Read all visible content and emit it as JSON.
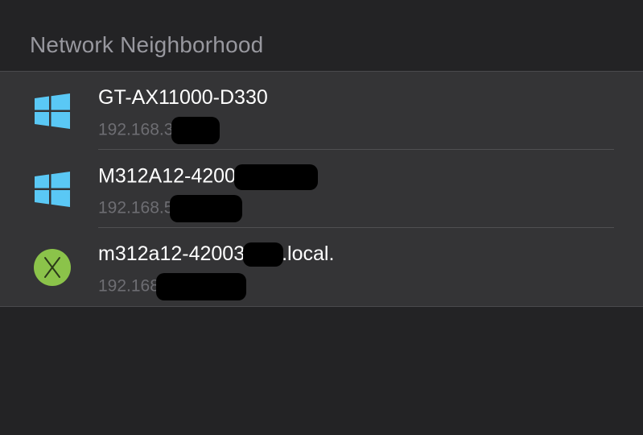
{
  "section": {
    "title": "Network Neighborhood"
  },
  "devices": [
    {
      "name": "GT-AX11000-D330",
      "address": "192.168.3",
      "icon": "windows-logo-icon",
      "icon_color": "#5ac8f5"
    },
    {
      "name": "M312A12-4200",
      "address": "192.168.5",
      "icon": "windows-logo-icon",
      "icon_color": "#5ac8f5"
    },
    {
      "name_prefix": "m312a12-42003",
      "name_suffix": ".local.",
      "address": "192.168",
      "icon": "macos-x-icon",
      "icon_color": "#8bc34a"
    }
  ],
  "colors": {
    "background": "#232325",
    "list_background": "#343436",
    "header_text": "#98989f",
    "title_text": "#ffffff",
    "subtitle_text": "#6d6d72"
  }
}
